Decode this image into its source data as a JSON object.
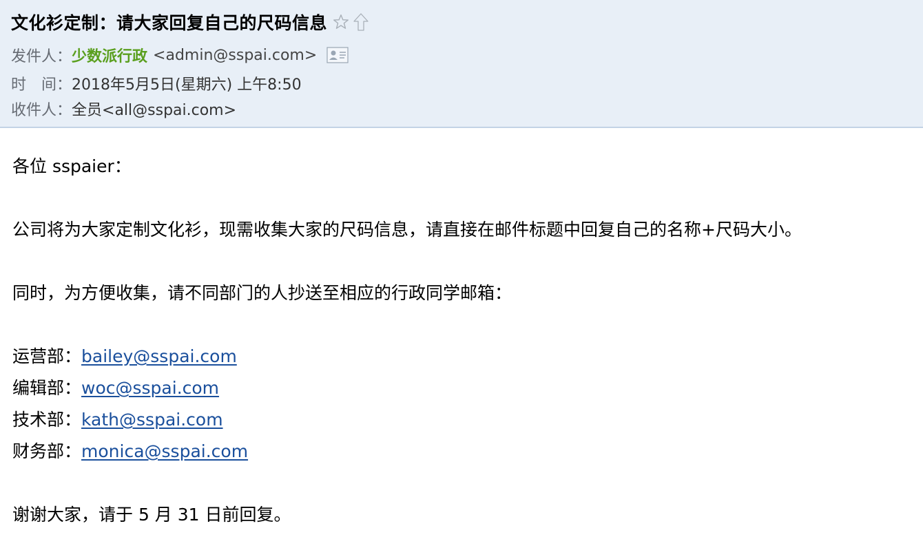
{
  "email": {
    "subject": "文化衫定制：请大家回复自己的尺码信息",
    "icons": {
      "star": "star-outline-icon",
      "up": "arrow-up-outline-icon",
      "contact": "contact-card-icon"
    },
    "from_label": "发件人：",
    "from_name": "少数派行政",
    "from_email": "<admin@sspai.com>",
    "time_label": "时　间：",
    "time_value": "2018年5月5日(星期六) 上午8:50",
    "to_label": "收件人：",
    "to_value": "全员<all@sspai.com>",
    "colors": {
      "header_bg": "#e8eff7",
      "sender_green": "#5a9f1e",
      "link_blue": "#1a4f9c"
    }
  },
  "body": {
    "greeting": "各位 sspaier：",
    "paragraph1": "公司将为大家定制文化衫，现需收集大家的尺码信息，请直接在邮件标题中回复自己的名称+尺码大小。",
    "paragraph2": "同时，为方便收集，请不同部门的人抄送至相应的行政同学邮箱：",
    "departments": [
      {
        "label": "运营部：",
        "email": "bailey@sspai.com"
      },
      {
        "label": "编辑部：",
        "email": "woc@sspai.com"
      },
      {
        "label": "技术部：",
        "email": "kath@sspai.com"
      },
      {
        "label": "财务部：",
        "email": "monica@sspai.com"
      }
    ],
    "closing": "谢谢大家，请于 5 月 31 日前回复。"
  }
}
